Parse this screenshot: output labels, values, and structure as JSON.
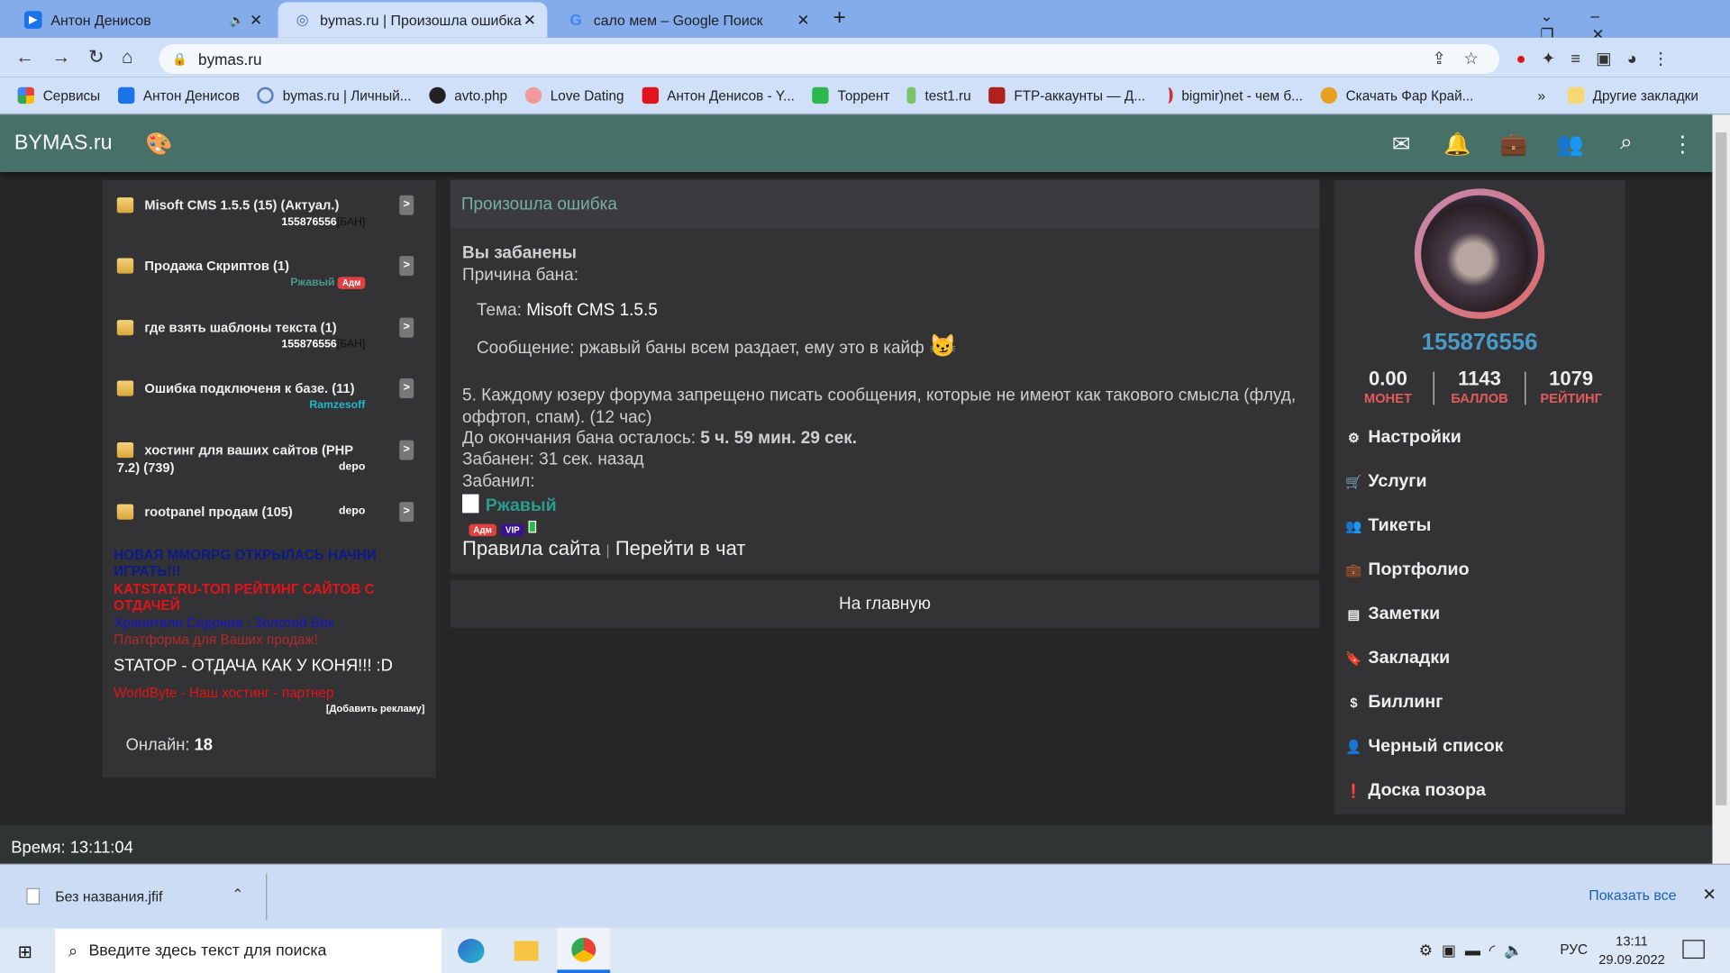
{
  "browser": {
    "tabs": [
      {
        "title": "Антон Денисов",
        "icon": "play-icon"
      },
      {
        "title": "bymas.ru | Произошла ошибка",
        "icon": "broadcast-icon"
      },
      {
        "title": "сало мем – Google Поиск",
        "icon": "google-icon"
      }
    ],
    "url": "bymas.ru",
    "bookmarks": [
      "Сервисы",
      "Антон Денисов",
      "bymas.ru | Личный...",
      "avto.php",
      "Love Dating",
      "Антон Денисов - Y...",
      "Торрент",
      "test1.ru",
      "FTP-аккаунты — Д...",
      "bigmir)net - чем б...",
      "Скачать Фар Край..."
    ],
    "more": "»",
    "other_bookmarks": "Другие закладки"
  },
  "site": {
    "logo": "BYMAS.ru",
    "accent": "#467068",
    "header_icons": [
      "mail-icon",
      "bell-icon",
      "briefcase-icon",
      "people-icon",
      "search-icon",
      "more-vert-icon"
    ]
  },
  "left": {
    "topics": [
      {
        "title": "Misoft CMS 1.5.5 (15) (Актуал.)",
        "author": "155876556",
        "ban": "[БАН]"
      },
      {
        "title": "Продажа Скриптов (1)",
        "author": "Ржавый",
        "badge": "Адм"
      },
      {
        "title": "где взять шаблоны текста (1)",
        "author": "155876556",
        "ban": "[БАН]"
      },
      {
        "title": "Ошибка подключеня к базе. (11)",
        "author": "Ramzesoff"
      },
      {
        "title": "хостинг для ваших сайтов (PHP 7.2) (739)",
        "author": "depo"
      },
      {
        "title": "rootpanel продам (105)",
        "author": "depo"
      }
    ],
    "ads": [
      {
        "text": "НОВАЯ MMORPG ОТКРЫЛАСЬ НАЧНИ ИГРАТЬ!!!",
        "color": "#0b1a8a"
      },
      {
        "text": "KATSTAT.RU-ТОП РЕЙТИНГ САЙТОВ С ОТДАЧЕЙ",
        "color": "#e0141a"
      },
      {
        "text": "Хранители Сидонии : Золотой Век",
        "color": "#1414d0"
      },
      {
        "text": "Платформа для Ваших продаж!",
        "color": "#b02a2a"
      },
      {
        "text": "STATOP - ОТДАЧА КАК У КОНЯ!!! :D",
        "color": "#ffffff"
      },
      {
        "text": "WorldByte - Наш хостинг - партнер",
        "color": "#e0141a"
      }
    ],
    "add_ad": "[Добавить рекламу]",
    "online_label": "Онлайн:",
    "online_count": "18"
  },
  "main": {
    "title": "Произошла ошибка",
    "banned": "Вы забанены",
    "reason_label": "Причина бана:",
    "topic_label": "Тема:",
    "topic_value": "Misoft CMS 1.5.5",
    "message_label": "Сообщение:",
    "message_value": "ржавый баны всем раздает, ему это в кайф",
    "rule": "5. Каждому юзеру форума запрещено писать сообщения, которые не имеют как такового смысла (флуд, оффтоп, спам). (12 час)",
    "remaining_label": "До окончания бана осталось:",
    "remaining_value": "5 ч. 59 мин. 29 сек.",
    "banned_ago": "Забанен: 31 сек. назад",
    "banned_by_label": "Забанил:",
    "banned_by": "Ржавый",
    "badges": [
      "Адм",
      "VIP"
    ],
    "rules_link": "Правила сайта",
    "sep": "|",
    "chat_link": "Перейти в чат",
    "home": "На главную"
  },
  "profile": {
    "username": "155876556",
    "stats": [
      {
        "value": "0.00",
        "label": "МОНЕТ"
      },
      {
        "value": "1143",
        "label": "БАЛЛОВ"
      },
      {
        "value": "1079",
        "label": "РЕЙТИНГ"
      }
    ],
    "menu": [
      {
        "label": "Настройки",
        "icon": "gear-icon"
      },
      {
        "label": "Услуги",
        "icon": "cart-icon"
      },
      {
        "label": "Тикеты",
        "icon": "people-icon"
      },
      {
        "label": "Портфолио",
        "icon": "briefcase-icon"
      },
      {
        "label": "Заметки",
        "icon": "notes-icon"
      },
      {
        "label": "Закладки",
        "icon": "bookmark-icon"
      },
      {
        "label": "Биллинг",
        "icon": "dollar-icon"
      },
      {
        "label": "Черный список",
        "icon": "person-icon"
      },
      {
        "label": "Доска позора",
        "icon": "alert-icon"
      }
    ]
  },
  "footer": {
    "time": "Время: 13:11:04"
  },
  "download": {
    "file": "Без названия.jfif",
    "show_all": "Показать все"
  },
  "taskbar": {
    "search_placeholder": "Введите здесь текст для поиска",
    "lang": "РУС",
    "time": "13:11",
    "date": "29.09.2022"
  }
}
